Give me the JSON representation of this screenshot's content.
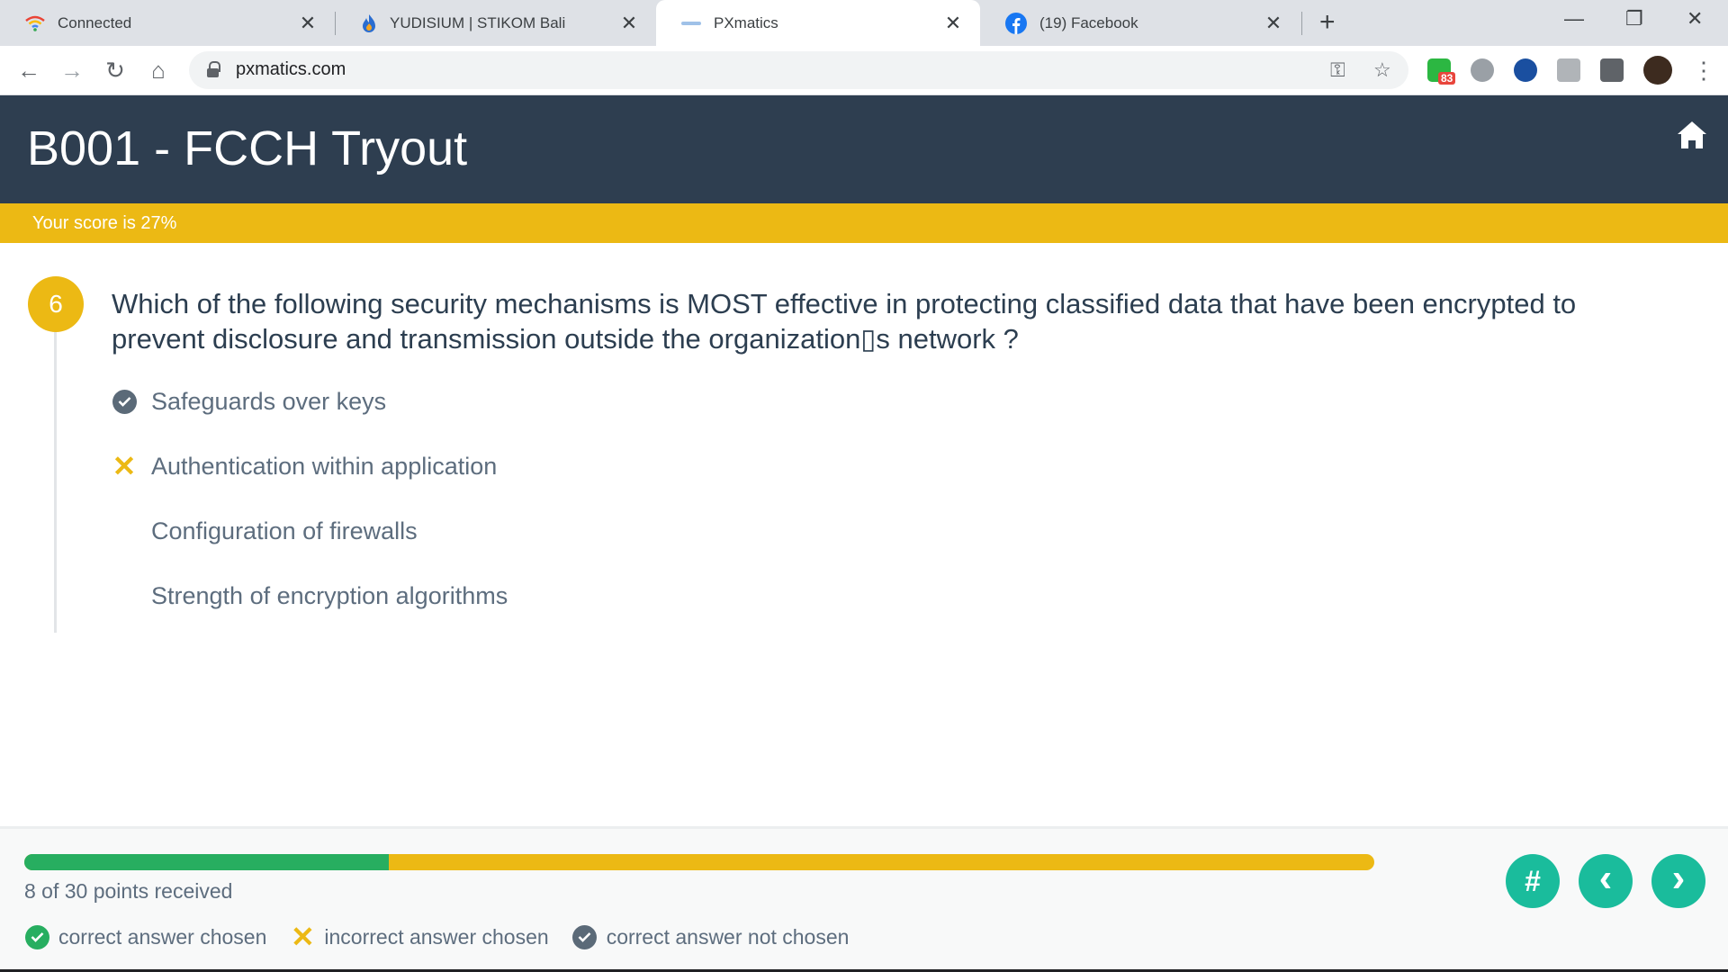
{
  "browser": {
    "tabs": [
      {
        "title": "Connected",
        "icon": "wifi-icon",
        "active": false
      },
      {
        "title": "YUDISIUM | STIKOM Bali",
        "icon": "flame-icon",
        "active": false
      },
      {
        "title": "PXmatics",
        "icon": "pxmatics-icon",
        "active": true
      },
      {
        "title": "(19) Facebook",
        "icon": "facebook-icon",
        "active": false
      }
    ],
    "url": "pxmatics.com",
    "extension_badge": "83"
  },
  "page": {
    "title": "B001 - FCCH Tryout",
    "score_text": "Your score is 27%"
  },
  "question": {
    "number": "6",
    "text": "Which of the following security mechanisms is MOST effective in protecting classified data that have been encrypted to prevent disclosure and transmission outside the organization▯s network ?",
    "options": [
      {
        "label": "Safeguards over keys",
        "status": "correct_not_chosen"
      },
      {
        "label": "Authentication within application",
        "status": "incorrect_chosen"
      },
      {
        "label": "Configuration of firewalls",
        "status": "none"
      },
      {
        "label": "Strength of encryption algorithms",
        "status": "none"
      }
    ]
  },
  "footer": {
    "progress_fraction": 0.27,
    "points_text": "8 of 30 points received",
    "legend": [
      {
        "label": "correct answer chosen",
        "icon": "check-circle-green-icon"
      },
      {
        "label": "incorrect answer chosen",
        "icon": "x-mark-icon"
      },
      {
        "label": "correct answer not chosen",
        "icon": "check-circle-gray-icon"
      }
    ],
    "buttons": {
      "grid": "#",
      "prev": "‹",
      "next": "›"
    }
  },
  "colors": {
    "header_bg": "#2e3e50",
    "accent_yellow": "#ecb914",
    "success_green": "#27ae60",
    "teal_button": "#1abc9c"
  }
}
